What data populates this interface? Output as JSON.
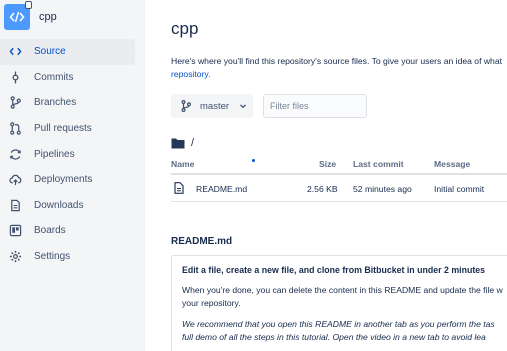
{
  "repo": {
    "name": "cpp"
  },
  "sidebar": {
    "items": [
      {
        "label": "Source",
        "icon": "code-icon",
        "active": true
      },
      {
        "label": "Commits",
        "icon": "commit-icon"
      },
      {
        "label": "Branches",
        "icon": "branch-icon"
      },
      {
        "label": "Pull requests",
        "icon": "pull-request-icon"
      },
      {
        "label": "Pipelines",
        "icon": "pipelines-icon"
      },
      {
        "label": "Deployments",
        "icon": "cloud-upload-icon"
      },
      {
        "label": "Downloads",
        "icon": "document-icon"
      },
      {
        "label": "Boards",
        "icon": "board-icon"
      },
      {
        "label": "Settings",
        "icon": "gear-icon"
      }
    ]
  },
  "main": {
    "title": "cpp",
    "description_line1": "Here's where you'll find this repository's source files. To give your users an idea of what",
    "description_link": "repository",
    "description_end": ".",
    "branch": "master",
    "filter_placeholder": "Filter files",
    "path": "/"
  },
  "table": {
    "headers": {
      "name": "Name",
      "size": "Size",
      "last_commit": "Last commit",
      "message": "Message"
    },
    "rows": [
      {
        "name": "README.md",
        "size": "2.56 KB",
        "last_commit": "52 minutes ago",
        "message": "Initial commit"
      }
    ]
  },
  "readme": {
    "title": "README.md",
    "heading": "Edit a file, create a new file, and clone from Bitbucket in under 2 minutes",
    "p1_line1": "When you're done, you can delete the content in this README and update the file w",
    "p1_line2": "your repository.",
    "p2_line1": "We recommend that you open this README in another tab as you perform the tas",
    "p2_line2": "full demo of all the steps in this tutorial. Open the video in a new tab to avoid lea"
  },
  "colors": {
    "accent": "#0052cc",
    "sidebar_bg": "#f4f5f7",
    "avatar": "#4c9aff"
  }
}
